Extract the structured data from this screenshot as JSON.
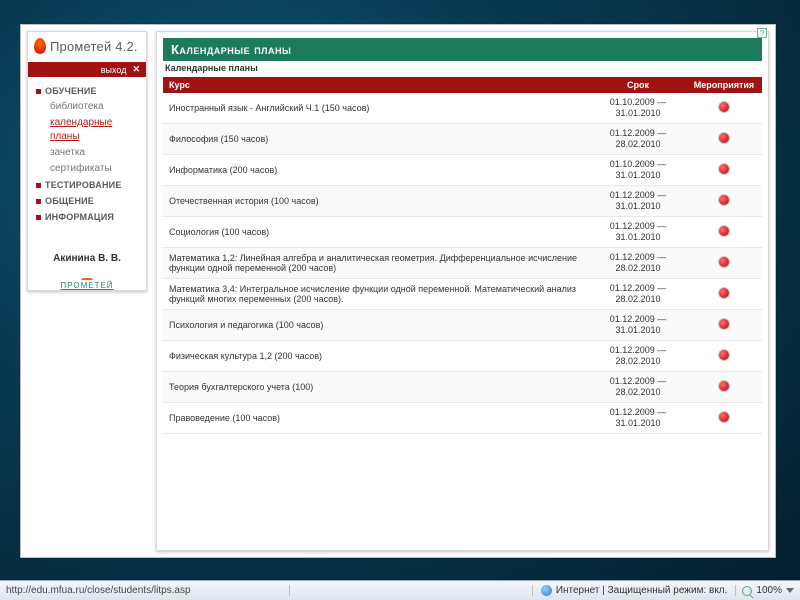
{
  "brand": {
    "name": "Прометей",
    "version": "4.2."
  },
  "sidebar": {
    "exit_label": "выход",
    "nav": [
      {
        "label": "ОБУЧЕНИЕ",
        "subs": [
          {
            "label": "библиотека"
          },
          {
            "label": "календарные планы",
            "active": true
          },
          {
            "label": "зачетка"
          },
          {
            "label": "сертификаты"
          }
        ]
      },
      {
        "label": "ТЕСТИРОВАНИЕ"
      },
      {
        "label": "ОБЩЕНИЕ"
      },
      {
        "label": "ИНФОРМАЦИЯ"
      }
    ],
    "user": "Акинина В. В.",
    "footer_brand": "ПРОМЕТЕЙ"
  },
  "content": {
    "title": "Календарные планы",
    "subtitle": "Календарные планы",
    "columns": {
      "course": "Курс",
      "term": "Срок",
      "actions": "Мероприятия"
    },
    "rows": [
      {
        "course": "Иностранный язык - Английский Ч.1 (150 часов)",
        "from": "01.10.2009",
        "to": "31.01.2010"
      },
      {
        "course": "Философия (150 часов)",
        "from": "01.12.2009",
        "to": "28.02.2010"
      },
      {
        "course": "Информатика (200 часов)",
        "from": "01.10.2009",
        "to": "31.01.2010"
      },
      {
        "course": "Отечественная история (100 часов)",
        "from": "01.12.2009",
        "to": "31.01.2010"
      },
      {
        "course": "Социология (100 часов)",
        "from": "01.12.2009",
        "to": "31.01.2010"
      },
      {
        "course": "Математика 1,2: Линейная алгебра и аналитическая геометрия. Дифференциальное исчисление функции одной переменной (200 часов)",
        "from": "01.12.2009",
        "to": "28.02.2010"
      },
      {
        "course": "Математика 3,4: Интегральное исчисление функции одной переменной. Математический анализ функций многих переменных (200 часов).",
        "from": "01.12.2009",
        "to": "28.02.2010"
      },
      {
        "course": "Психология и педагогика (100 часов)",
        "from": "01.12.2009",
        "to": "31.01.2010"
      },
      {
        "course": "Физическая культура 1,2 (200 часов)",
        "from": "01.12.2009",
        "to": "28.02.2010"
      },
      {
        "course": "Теория бухгалтерского учета (100)",
        "from": "01.12.2009",
        "to": "28.02.2010"
      },
      {
        "course": "Правоведение (100 часов)",
        "from": "01.12.2009",
        "to": "31.01.2010"
      }
    ]
  },
  "statusbar": {
    "url": "http://edu.mfua.ru/close/students/litps.asp",
    "zone": "Интернет | Защищенный режим: вкл.",
    "zoom": "100%"
  }
}
